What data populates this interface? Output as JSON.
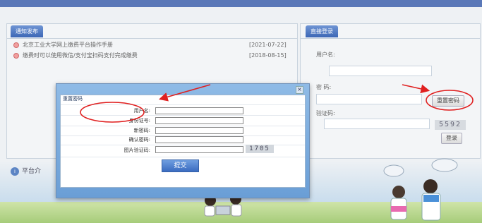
{
  "news": {
    "tab": "通知发布",
    "items": [
      {
        "title": "北京工业大学网上缴费平台操作手册",
        "date": "[2021-07-22]"
      },
      {
        "title": "缴费时可以使用微信/支付宝扫码支付完成缴费",
        "date": "[2018-08-15]"
      }
    ]
  },
  "login": {
    "tab": "直接登录",
    "username_label": "用户名:",
    "password_label": "密 码:",
    "reset_button": "重置密码",
    "captcha_label": "验证码:",
    "captcha": "5592",
    "login_button": "登录"
  },
  "intro": {
    "label": "平台介",
    "icon": "info-icon"
  },
  "modal": {
    "title": "重置密码",
    "close": "×",
    "fields": [
      {
        "label": "用户名:"
      },
      {
        "label": "身份证号:"
      },
      {
        "label": "新密码:"
      },
      {
        "label": "确认密码:"
      },
      {
        "label": "图片验证码:"
      }
    ],
    "captcha": "1705",
    "submit": "提交"
  },
  "colors": {
    "accent": "#3c67b6",
    "annotation": "#e02020"
  }
}
